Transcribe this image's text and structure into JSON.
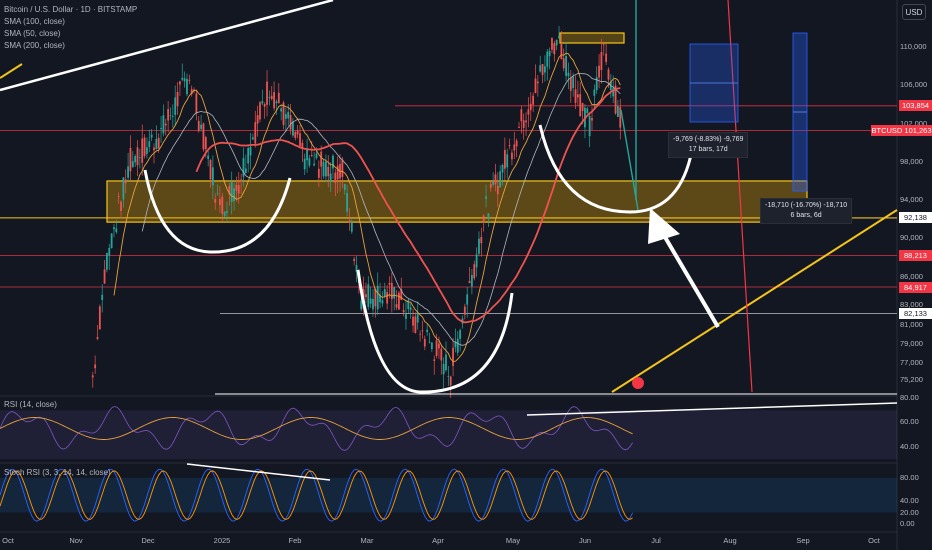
{
  "header": {
    "title": "Bitcoin / U.S. Dollar · 1D · BITSTAMP",
    "sma_labels": [
      "SMA (100, close)",
      "SMA (50, close)",
      "SMA (200, close)"
    ],
    "currency_button": "USD"
  },
  "chart_data": [
    {
      "type": "line",
      "title": "Bitcoin / U.S. Dollar · 1D · BITSTAMP",
      "symbol": "BTCUSD",
      "x_ticks": [
        "Oct",
        "Nov",
        "Dec",
        "2025",
        "Feb",
        "Mar",
        "Apr",
        "May",
        "Jun",
        "Jul",
        "Aug",
        "Sep",
        "Oct"
      ],
      "y_ticks": [
        "75,200",
        "77,000",
        "79,000",
        "81,000",
        "83,000",
        "86,000",
        "90,000",
        "94,000",
        "98,000",
        "102,000",
        "106,000",
        "110,000"
      ],
      "price_labels": [
        {
          "text": "103,854",
          "value": 103854,
          "color": "#f23645"
        },
        {
          "text": "BTCUSD  101,263",
          "value": 101263,
          "color": "#f23645"
        },
        {
          "text": "92,138",
          "value": 92138,
          "color": "#131722"
        },
        {
          "text": "88,213",
          "value": 88213,
          "color": "#f23645"
        },
        {
          "text": "84,917",
          "value": 84917,
          "color": "#f23645"
        },
        {
          "text": "82,133",
          "value": 82133,
          "color": "#131722"
        }
      ],
      "approx_closes": [
        {
          "date": "2024-11-06",
          "close": 75500
        },
        {
          "date": "2024-11-12",
          "close": 88000
        },
        {
          "date": "2024-11-22",
          "close": 98000
        },
        {
          "date": "2024-12-05",
          "close": 101000
        },
        {
          "date": "2024-12-17",
          "close": 107000
        },
        {
          "date": "2024-12-30",
          "close": 93000
        },
        {
          "date": "2025-01-07",
          "close": 96000
        },
        {
          "date": "2025-01-20",
          "close": 106000
        },
        {
          "date": "2025-02-05",
          "close": 98000
        },
        {
          "date": "2025-02-20",
          "close": 97000
        },
        {
          "date": "2025-02-28",
          "close": 84000
        },
        {
          "date": "2025-03-15",
          "close": 84000
        },
        {
          "date": "2025-04-07",
          "close": 76000
        },
        {
          "date": "2025-04-22",
          "close": 93000
        },
        {
          "date": "2025-05-10",
          "close": 104000
        },
        {
          "date": "2025-05-22",
          "close": 111000
        },
        {
          "date": "2025-06-05",
          "close": 101500
        },
        {
          "date": "2025-06-11",
          "close": 110000
        },
        {
          "date": "2025-06-19",
          "close": 101263
        }
      ],
      "annotations": [
        {
          "text": "-9,769 (-8.83%) -9,769",
          "sub": "17 bars, 17d"
        },
        {
          "text": "-18,710 (-16.70%) -18,710",
          "sub": "6 bars, 6d"
        }
      ]
    },
    {
      "type": "line",
      "title": "RSI (14, close)",
      "y_ticks": [
        "80.00",
        "60.00",
        "40.00"
      ]
    },
    {
      "type": "line",
      "title": "Stoch RSI (3, 3, 14, 14, close)",
      "y_ticks": [
        "80.00",
        "40.00",
        "20.00",
        "0.00"
      ]
    }
  ],
  "colors": {
    "background": "#131722",
    "up": "#26a69a",
    "down": "#ef5350",
    "zone": "#f5c518",
    "resistance": "#f23645",
    "sma200": "#ef5350",
    "sma100": "#b2b5be",
    "sma50": "#e6a23c"
  }
}
